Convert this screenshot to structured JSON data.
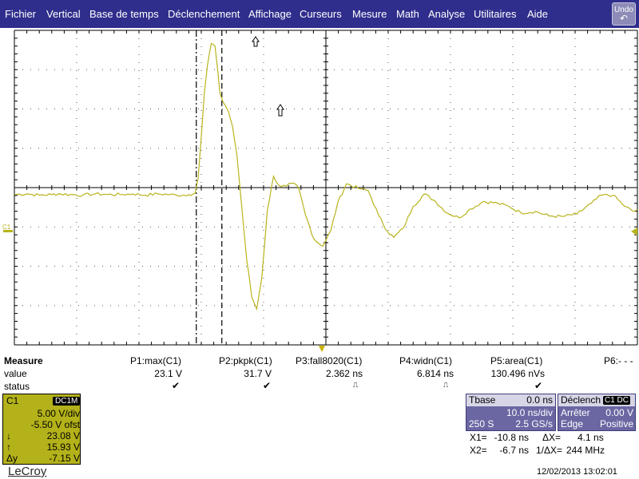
{
  "menu": {
    "items": [
      "Fichier",
      "Vertical",
      "Base de temps",
      "Déclenchement",
      "Affichage",
      "Curseurs",
      "Mesure",
      "Math",
      "Analyse",
      "Utilitaires",
      "Aide"
    ],
    "undo_label": "Undo",
    "undo_icon": "undo-arrow-icon"
  },
  "graph": {
    "channel_marker": "C1",
    "trace_color": "#b8b41c",
    "grid_color": "#000000",
    "trigger_marker_color": "#c9b400",
    "trace_description_omitted": false
  },
  "chart_data": {
    "type": "line",
    "x_unit": "ns",
    "y_unit": "V",
    "xlim": [
      -40,
      60
    ],
    "ylim": [
      -25,
      25
    ],
    "x_divisions": 10,
    "y_divisions": 8,
    "series": [
      {
        "x": [
          -40,
          -38,
          -36,
          -34,
          -33,
          -31,
          -29,
          -27,
          -25,
          -23,
          -21,
          -19,
          -17,
          -15,
          -14,
          -12,
          -11,
          -10.5,
          -10,
          -9.5,
          -9,
          -8.4,
          -7.8,
          -7,
          -6.5,
          -6.1,
          -5.6,
          -5,
          -4.3,
          -3.5,
          -2.7,
          -1.9,
          -1.1,
          -0.3,
          0.6,
          1.6,
          2.5,
          3.6,
          4.5,
          5.6,
          6.7,
          8.1,
          9.5,
          10.8,
          11.9,
          13.3,
          15.2,
          16.8,
          18.5,
          19.9,
          20.9,
          22.4,
          24,
          25.8,
          27.6,
          29.4,
          31.4,
          33.2,
          35.3,
          37.6,
          39.4,
          41.3,
          43.6,
          45.8,
          48,
          50.3,
          52.6,
          54.2,
          56.1,
          58,
          59.4,
          60
        ],
        "y": [
          -1.1,
          -1.0,
          -1.2,
          -1.1,
          -1.0,
          -1.1,
          -1.2,
          -1.0,
          -1.1,
          -1.1,
          -1.0,
          -1.2,
          -1.0,
          -1.1,
          -1.2,
          -1.1,
          -0.9,
          1.5,
          8.1,
          15.1,
          19.5,
          22.9,
          22.5,
          15.0,
          13.6,
          13.0,
          12.0,
          9.8,
          5.3,
          -3.1,
          -11.5,
          -17.4,
          -19.3,
          -14.4,
          -3.6,
          1.8,
          0.3,
          0.2,
          0.7,
          0.0,
          -4.3,
          -8.2,
          -9.3,
          -6.8,
          -2.4,
          0.6,
          -0.1,
          -0.5,
          -4.5,
          -7.0,
          -7.9,
          -6.5,
          -3.0,
          -1.0,
          -2.2,
          -4.0,
          -4.8,
          -3.4,
          -2.2,
          -2.5,
          -3.0,
          -4.0,
          -3.8,
          -4.5,
          -4.6,
          -4.2,
          -2.5,
          -1.2,
          -1.2,
          -3.0,
          -3.8,
          -3.5
        ]
      }
    ],
    "cursors": {
      "x1": -10.8,
      "x2": -6.7
    }
  },
  "measure": {
    "title": "Measure",
    "row_value_label": "value",
    "row_status_label": "status",
    "params": [
      {
        "label": "P1:max(C1)",
        "value": "23.1 V",
        "status": "check"
      },
      {
        "label": "P2:pkpk(C1)",
        "value": "31.7 V",
        "status": "check"
      },
      {
        "label": "P3:fall8020(C1)",
        "value": "2.362 ns",
        "status": "pulse"
      },
      {
        "label": "P4:widn(C1)",
        "value": "6.814 ns",
        "status": "pulse"
      },
      {
        "label": "P5:area(C1)",
        "value": "130.496 nVs",
        "status": "check"
      },
      {
        "label": "P6:- - -",
        "value": "",
        "status": ""
      }
    ],
    "check_glyph": "✔",
    "pulse_glyph": "⎍"
  },
  "channel": {
    "name": "C1",
    "coupling": "DC1M",
    "volts_div": "5.00 V/div",
    "offset": "-5.50 V ofst",
    "cursor_down_value": "23.08 V",
    "cursor_up_value": "15.93 V",
    "delta_y_label": "Δy",
    "delta_y_value": "-7.15 V",
    "down_glyph": "↓",
    "up_glyph": "↑",
    "color": "#b4b21a"
  },
  "timebase": {
    "title": "Tbase",
    "delay": "0.0 ns",
    "time_div": "10.0 ns/div",
    "samples": "250 S",
    "sample_rate": "2.5 GS/s"
  },
  "trigger": {
    "title": "Déclench",
    "tag": "C1 DC",
    "mode_label": "Arrêter",
    "level": "0.00 V",
    "type": "Edge",
    "slope": "Positive"
  },
  "cursors": {
    "x1_label": "X1=",
    "x1_value": "-10.8 ns",
    "x2_label": "X2=",
    "x2_value": "-6.7 ns",
    "dx_label": "ΔX=",
    "dx_value": "4.1 ns",
    "inv_dx_label": "1/ΔX=",
    "inv_dx_value": "244 MHz"
  },
  "footer": {
    "brand": "LeCroy",
    "datetime": "12/02/2013 13:02:01"
  }
}
